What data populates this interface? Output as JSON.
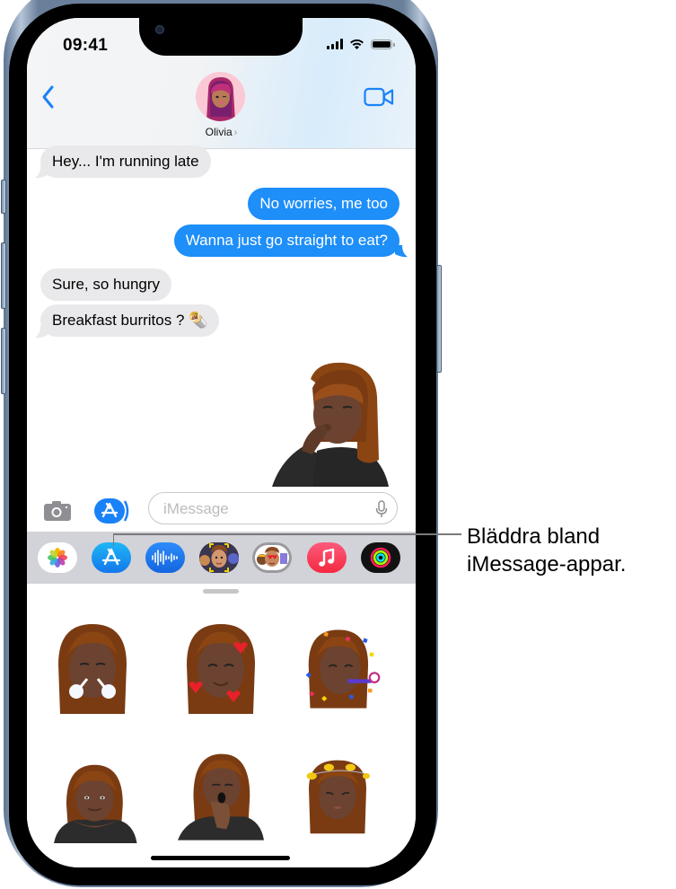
{
  "status_bar": {
    "time": "09:41",
    "icons": [
      "cellular-signal-icon",
      "wifi-icon",
      "battery-icon"
    ]
  },
  "header": {
    "back_icon": "chevron-left-icon",
    "contact_name": "Olivia",
    "contact_chevron": "›",
    "video_icon": "video-camera-icon",
    "accent_color": "#1a82f7"
  },
  "messages": [
    {
      "direction": "incoming",
      "text": "Hey... I'm running late"
    },
    {
      "direction": "outgoing",
      "text": "No worries, me too"
    },
    {
      "direction": "outgoing",
      "text": "Wanna just go straight to eat?"
    },
    {
      "direction": "incoming",
      "text": "Sure, so hungry"
    },
    {
      "direction": "incoming",
      "text": "Breakfast burritos ? 🌯"
    },
    {
      "direction": "outgoing",
      "type": "sticker",
      "description": "memoji blowing a kiss"
    }
  ],
  "input_bar": {
    "camera_icon": "camera-icon",
    "apps_icon": "app-store-icon",
    "placeholder": "iMessage",
    "value": "",
    "mic_icon": "microphone-icon"
  },
  "app_drawer": {
    "apps": [
      {
        "name": "Photos",
        "icon": "photos-icon"
      },
      {
        "name": "App Store",
        "icon": "app-store-icon"
      },
      {
        "name": "Audio Message",
        "icon": "audio-waveform-icon"
      },
      {
        "name": "Memoji",
        "icon": "memoji-icon"
      },
      {
        "name": "Memoji Stickers",
        "icon": "memoji-stickers-icon",
        "selected": true
      },
      {
        "name": "Music",
        "icon": "music-icon"
      },
      {
        "name": "Activity",
        "icon": "activity-rings-icon"
      }
    ],
    "stickers": [
      {
        "description": "memoji huffing steam"
      },
      {
        "description": "memoji with hearts"
      },
      {
        "description": "memoji party blower with confetti"
      },
      {
        "description": "memoji hands under chin"
      },
      {
        "description": "memoji yawning"
      },
      {
        "description": "memoji dizzy with birds"
      }
    ]
  },
  "callout": {
    "line1": "Bläddra bland",
    "line2": "iMessage-appar."
  },
  "colors": {
    "outgoing_bubble": "#1e8ef8",
    "incoming_bubble": "#e9e9eb",
    "app_strip": "#d1d3d9"
  }
}
